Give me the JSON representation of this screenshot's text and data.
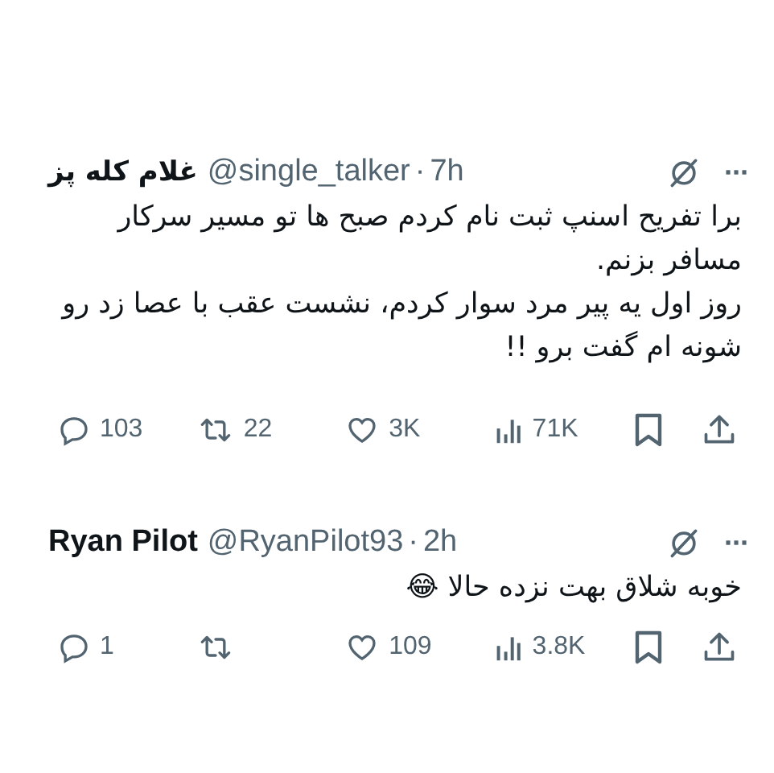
{
  "tweets": [
    {
      "name": "غلام کله پز",
      "handle": "@single_talker",
      "separator": "·",
      "time": "7h",
      "more": "···",
      "paragraphs": [
        "برا تفریح اسنپ ثبت نام کردم صبح ها تو مسیر سرکار مسافر بزنم.",
        "روز اول یه پیر مرد سوار کردم، نشست عقب با عصا زد رو شونه ام گفت برو !!"
      ],
      "actions": [
        {
          "kind": "share"
        },
        {
          "kind": "bookmark"
        },
        {
          "kind": "views",
          "count": "71K"
        },
        {
          "kind": "like",
          "count": "3K"
        },
        {
          "kind": "repost",
          "count": "22"
        },
        {
          "kind": "reply",
          "count": "103"
        }
      ]
    },
    {
      "name": "Ryan Pilot",
      "handle": "@RyanPilot93",
      "separator": "·",
      "time": "2h",
      "more": "···",
      "paragraphs": [
        "خوبه شلاق بهت نزده حالا 😂"
      ],
      "actions": [
        {
          "kind": "share"
        },
        {
          "kind": "bookmark"
        },
        {
          "kind": "views",
          "count": "3.8K"
        },
        {
          "kind": "like",
          "count": "109"
        },
        {
          "kind": "repost"
        },
        {
          "kind": "reply",
          "count": "1"
        }
      ]
    }
  ]
}
